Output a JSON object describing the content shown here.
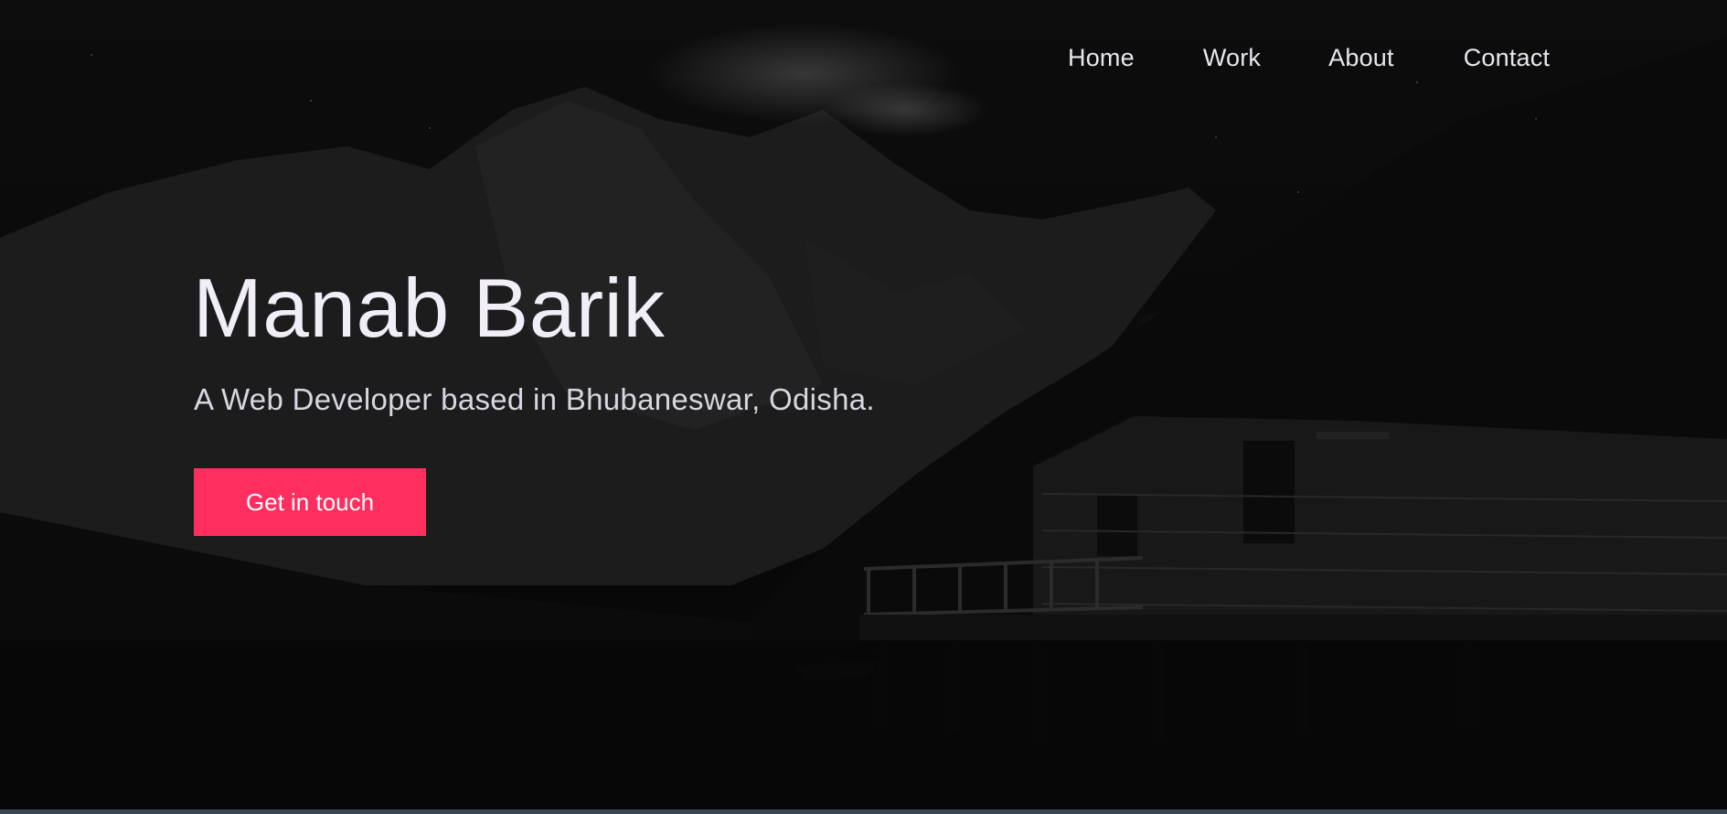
{
  "nav": {
    "items": [
      {
        "label": "Home"
      },
      {
        "label": "Work"
      },
      {
        "label": "About"
      },
      {
        "label": "Contact"
      }
    ]
  },
  "hero": {
    "title": "Manab Barik",
    "subtitle": "A Web Developer based in Bhubaneswar, Odisha.",
    "cta_label": "Get in touch",
    "background": "dark-mountain-lake-cabin-photo"
  },
  "colors": {
    "accent": "#ff2e5e",
    "text_primary": "#f1eef8",
    "text_secondary": "#d9d6e0",
    "background": "#060606",
    "bottom_strip": "#3a4653"
  }
}
